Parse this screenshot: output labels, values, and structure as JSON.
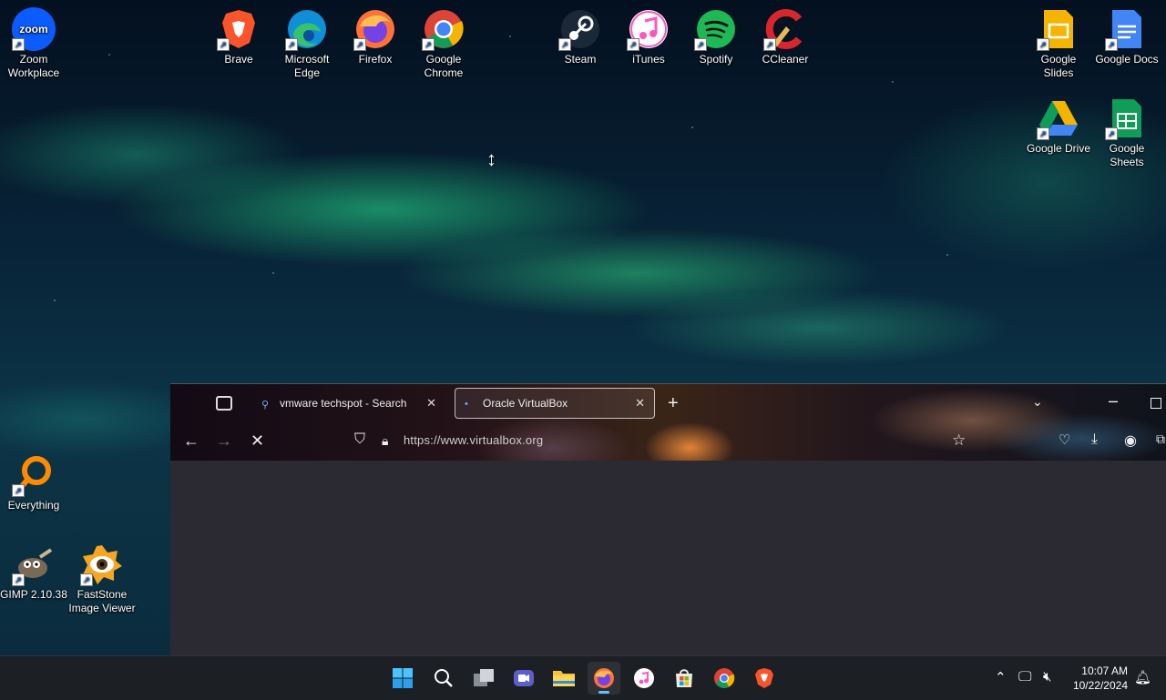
{
  "desktop": {
    "icons": [
      {
        "label": "Zoom Workplace",
        "icon": "zoom-icon",
        "color": "#0b5cff"
      },
      {
        "label": "Brave",
        "icon": "brave-icon",
        "color": "#fb542b"
      },
      {
        "label": "Microsoft Edge",
        "icon": "edge-icon",
        "color": "#0f8fd6"
      },
      {
        "label": "Firefox",
        "icon": "firefox-icon",
        "color": "#ff7139"
      },
      {
        "label": "Google Chrome",
        "icon": "chrome-icon",
        "color": "#34a853"
      },
      {
        "label": "Steam",
        "icon": "steam-icon",
        "color": "#1b2838"
      },
      {
        "label": "iTunes",
        "icon": "itunes-icon",
        "color": "#fa57c1"
      },
      {
        "label": "Spotify",
        "icon": "spotify-icon",
        "color": "#1db954"
      },
      {
        "label": "CCleaner",
        "icon": "ccleaner-icon",
        "color": "#d9262c"
      },
      {
        "label": "Google Slides",
        "icon": "google-slides-icon",
        "color": "#f4b400"
      },
      {
        "label": "Google Docs",
        "icon": "google-docs-icon",
        "color": "#4285f4"
      },
      {
        "label": "Google Drive",
        "icon": "google-drive-icon",
        "color": "#0f9d58"
      },
      {
        "label": "Google Sheets",
        "icon": "google-sheets-icon",
        "color": "#0f9d58"
      },
      {
        "label": "Everything",
        "icon": "everything-icon",
        "color": "#ff8a00"
      },
      {
        "label": "GIMP 2.10.38",
        "icon": "gimp-icon",
        "color": "#7a6a53"
      },
      {
        "label": "FastStone Image Viewer",
        "icon": "faststone-icon",
        "color": "#f5a623"
      }
    ]
  },
  "browser": {
    "tabs": [
      {
        "title": "vmware techspot - Search",
        "icon": "search-favicon-icon"
      },
      {
        "title": "Oracle VirtualBox",
        "icon": "virtualbox-favicon-icon"
      }
    ],
    "url": "https://www.virtualbox.org"
  },
  "taskbar": {
    "apps": [
      "start-icon",
      "search-icon",
      "task-view-icon",
      "meet-icon",
      "file-explorer-icon",
      "firefox-icon",
      "itunes-icon",
      "microsoft-store-icon",
      "chrome-icon",
      "brave-icon"
    ],
    "time": "10:07 AM",
    "date": "10/22/2024"
  }
}
